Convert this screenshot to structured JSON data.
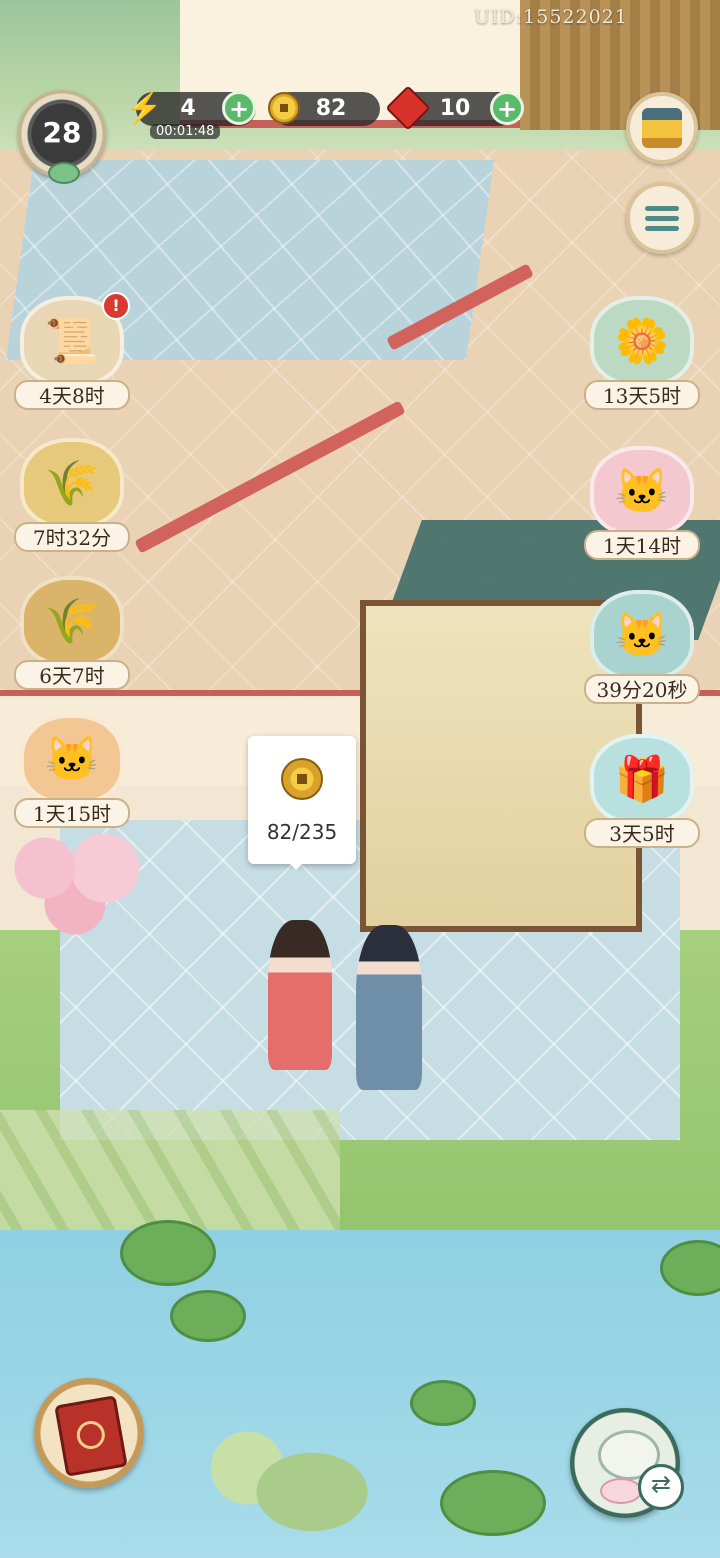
{
  "hud": {
    "uid": "UID:15522021",
    "level": "28",
    "energy": {
      "value": "4",
      "timer": "00:01:48",
      "icon": "lightning-icon"
    },
    "coins": {
      "value": "82",
      "icon": "coin-icon"
    },
    "gems": {
      "value": "10",
      "icon": "ruby-icon"
    }
  },
  "right_buttons": [
    {
      "name": "shop-button",
      "icon": "treasure-pavilion-icon"
    },
    {
      "name": "menu-button",
      "icon": "menu-icon"
    }
  ],
  "left_timers": [
    {
      "label": "4天8时",
      "icon": "scroll-box-icon",
      "alert": "!"
    },
    {
      "label": "7时32分",
      "icon": "golden-wheat-icon"
    },
    {
      "label": "6天7时",
      "icon": "wheat-field-icon"
    },
    {
      "label": "1天15时",
      "icon": "lucky-cat-icon"
    }
  ],
  "right_timers": [
    {
      "label": "13天5时",
      "icon": "chrysanthemum-icon"
    },
    {
      "label": "1天14时",
      "icon": "pink-cat-icon"
    },
    {
      "label": "39分20秒",
      "icon": "coin-cart-cat-icon"
    },
    {
      "label": "3天5时",
      "icon": "gift-box-cat-icon"
    }
  ],
  "coin_bubble": {
    "count": "82/235",
    "icon": "coin-icon"
  },
  "bottom_buttons": [
    {
      "name": "book-button",
      "icon": "red-book-icon"
    },
    {
      "name": "tea-button",
      "icon": "teapot-icon"
    }
  ],
  "colors": {
    "hud_bar": "#282828",
    "plus_green": "#5aba6a",
    "alert_red": "#d93a2f",
    "label_bg": "#fbf4e6"
  }
}
